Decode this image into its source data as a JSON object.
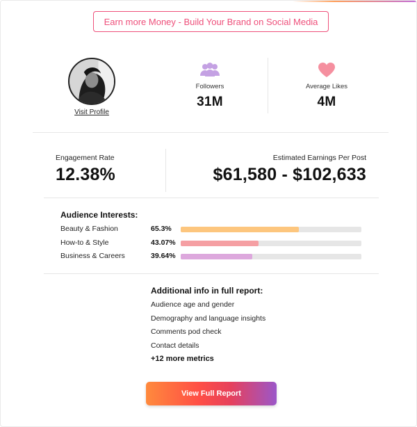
{
  "promo": {
    "label": "Earn more Money - Build Your Brand on Social Media"
  },
  "profile": {
    "visit_label": "Visit Profile"
  },
  "stats": {
    "followers": {
      "label": "Followers",
      "value": "31M",
      "icon": "people-icon"
    },
    "likes": {
      "label": "Average Likes",
      "value": "4M",
      "icon": "heart-icon"
    }
  },
  "engagement": {
    "label": "Engagement Rate",
    "value": "12.38%"
  },
  "earnings": {
    "label": "Estimated Earnings Per Post",
    "value": "$61,580 - $102,633"
  },
  "interests": {
    "title": "Audience Interests:",
    "items": [
      {
        "name": "Beauty & Fashion",
        "percent_label": "65.3%",
        "percent": 65.3,
        "color": "#fdc67e"
      },
      {
        "name": "How-to & Style",
        "percent_label": "43.07%",
        "percent": 43.07,
        "color": "#f59fa3"
      },
      {
        "name": "Business & Careers",
        "percent_label": "39.64%",
        "percent": 39.64,
        "color": "#dda8dd"
      }
    ]
  },
  "additional": {
    "title": "Additional info in full report:",
    "items": [
      "Audience age and gender",
      "Demography and language insights",
      "Comments pod check",
      "Contact details"
    ],
    "more": "+12 more metrics"
  },
  "cta": {
    "label": "View Full Report"
  },
  "colors": {
    "accent_pink": "#ee4f7a",
    "icon_purple": "#c4a1e3",
    "icon_pink": "#f58f9f"
  }
}
